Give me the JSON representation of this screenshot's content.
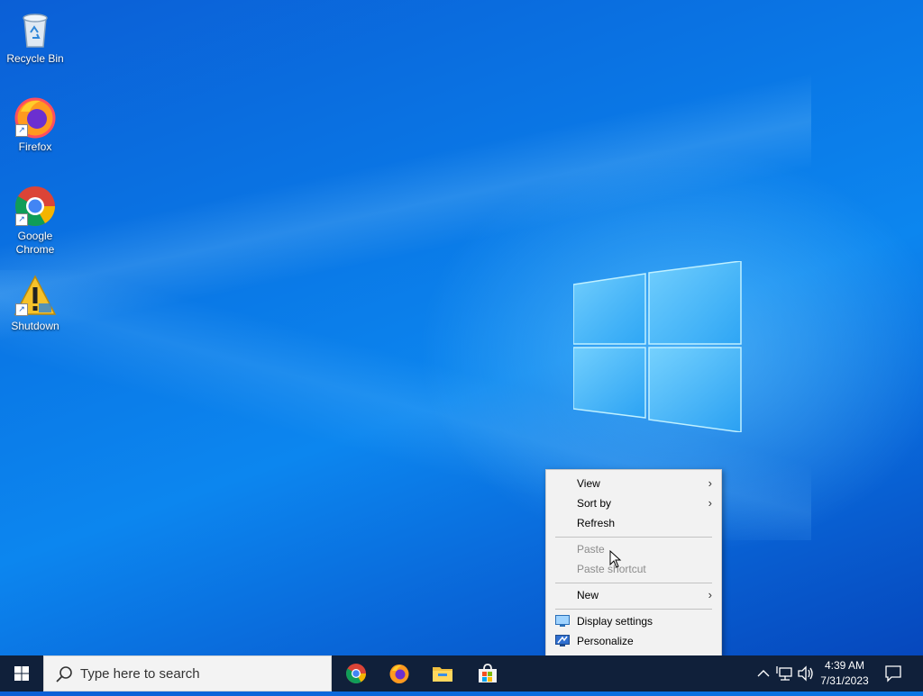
{
  "desktop": {
    "icons": [
      {
        "label": "Recycle Bin"
      },
      {
        "label": "Firefox"
      },
      {
        "label": "Google Chrome"
      },
      {
        "label": "Shutdown"
      }
    ]
  },
  "context_menu": {
    "items": [
      {
        "label": "View",
        "submenu": true,
        "enabled": true
      },
      {
        "label": "Sort by",
        "submenu": true,
        "enabled": true
      },
      {
        "label": "Refresh",
        "submenu": false,
        "enabled": true
      },
      {
        "label": "Paste",
        "submenu": false,
        "enabled": false
      },
      {
        "label": "Paste shortcut",
        "submenu": false,
        "enabled": false
      },
      {
        "label": "New",
        "submenu": true,
        "enabled": true
      },
      {
        "label": "Display settings",
        "icon": "display-icon",
        "enabled": true
      },
      {
        "label": "Personalize",
        "icon": "personalize-icon",
        "enabled": true
      }
    ]
  },
  "taskbar": {
    "search_placeholder": "Type here to search",
    "pinned": [
      "chrome-icon",
      "firefox-icon",
      "file-explorer-icon",
      "store-icon"
    ],
    "tray": {
      "time": "4:39 AM",
      "date": "7/31/2023"
    }
  },
  "colors": {
    "accent": "#0a78e6",
    "taskbar": "#10203a",
    "menu_bg": "#f2f2f2"
  }
}
